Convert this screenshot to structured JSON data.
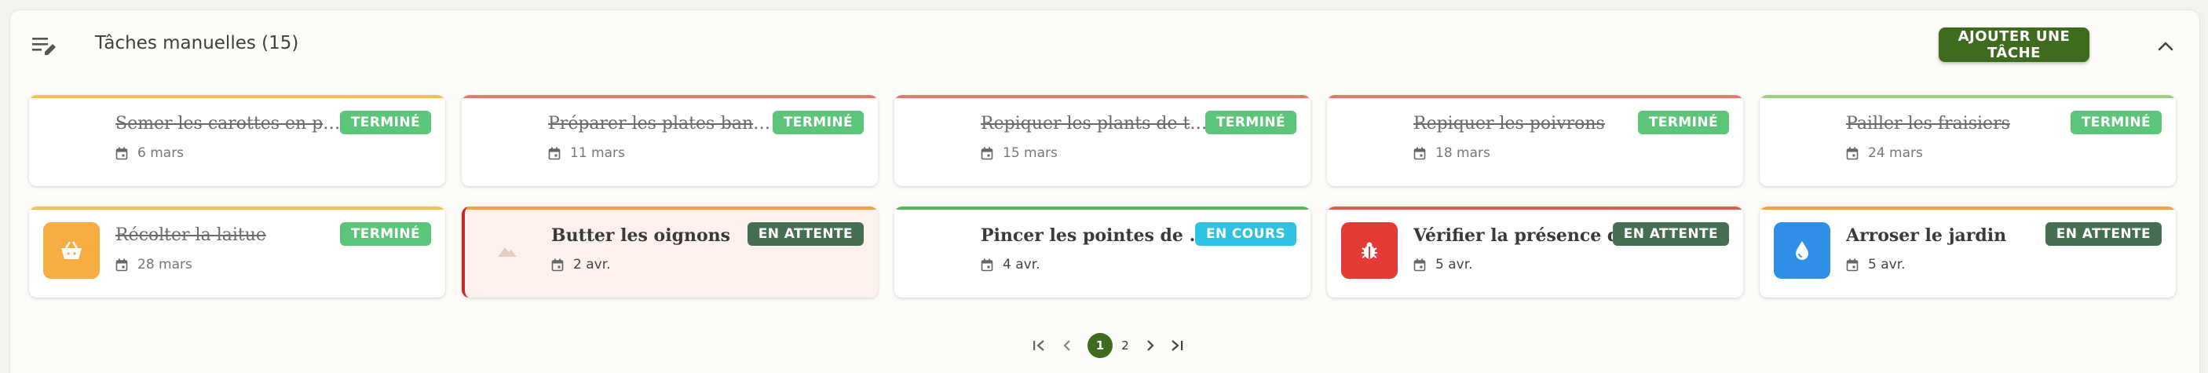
{
  "header": {
    "title": "Tâches manuelles (15)",
    "add_button": "AJOUTER UNE TÂCHE"
  },
  "tasks": [
    {
      "name": "Semer les carottes en plein champ",
      "date": "6 mars",
      "status": "TERMINÉ",
      "done": true,
      "accent": "#f2c14e"
    },
    {
      "name": "Préparer les plates-bandes",
      "date": "11 mars",
      "status": "TERMINÉ",
      "done": true,
      "accent": "#e8776a"
    },
    {
      "name": "Repiquer les plants de tomates",
      "date": "15 mars",
      "status": "TERMINÉ",
      "done": true,
      "accent": "#e8776a"
    },
    {
      "name": "Repiquer les poivrons",
      "date": "18 mars",
      "status": "TERMINÉ",
      "done": true,
      "accent": "#e8776a"
    },
    {
      "name": "Pailler les fraisiers",
      "date": "24 mars",
      "status": "TERMINÉ",
      "done": true,
      "accent": "#9ccf7f"
    },
    {
      "name": "Récolter la laitue",
      "date": "28 mars",
      "status": "TERMINÉ",
      "done": true,
      "accent": "#f2c14e",
      "icon": "basket-icon",
      "icon_bg": "#f6ae42"
    },
    {
      "name": "Butter les oignons",
      "date": "2 avr.",
      "status": "EN ATTENTE",
      "done": false,
      "accent": "#f2a43c",
      "icon": "mountain-icon",
      "alert": true
    },
    {
      "name": "Pincer les pointes de basilic",
      "date": "4 avr.",
      "status": "EN COURS",
      "done": false,
      "accent": "#5ab55f"
    },
    {
      "name": "Vérifier la présence de pucerons",
      "date": "5 avr.",
      "status": "EN ATTENTE",
      "done": false,
      "accent": "#e35a4b",
      "icon": "bug-icon",
      "icon_bg": "#e53b36"
    },
    {
      "name": "Arroser le jardin",
      "date": "5 avr.",
      "status": "EN ATTENTE",
      "done": false,
      "accent": "#f2a43c",
      "icon": "water-drop-icon",
      "icon_bg": "#2f8fe6"
    }
  ],
  "status_colors": {
    "TERMINÉ": "#5bc57a",
    "EN ATTENTE": "#466e52",
    "EN COURS": "#2fc1e0"
  },
  "pagination": {
    "pages": [
      "1",
      "2"
    ],
    "current": "1"
  }
}
